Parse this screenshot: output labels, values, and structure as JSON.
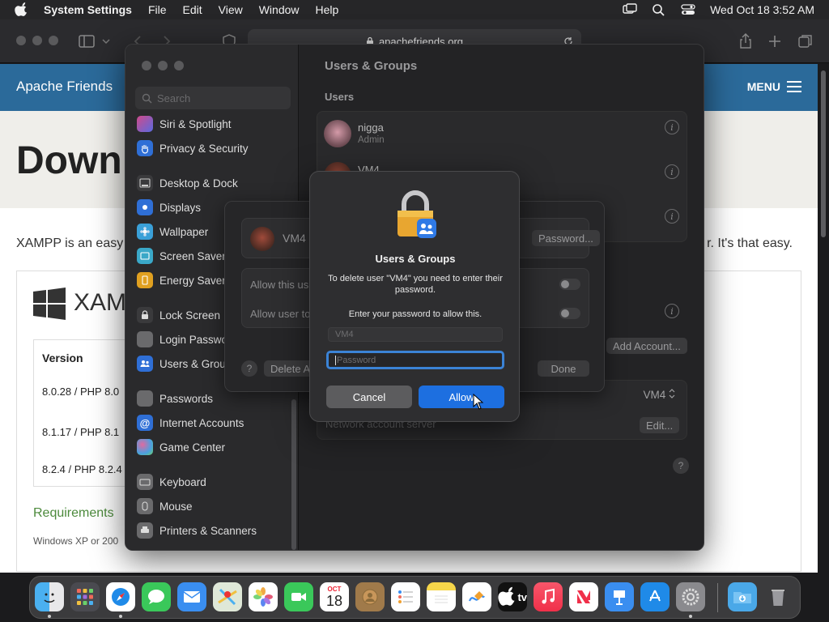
{
  "menubar": {
    "app": "System Settings",
    "items": [
      "File",
      "Edit",
      "View",
      "Window",
      "Help"
    ],
    "datetime": "Wed Oct 18  3:52 AM"
  },
  "safari": {
    "url": "apachefriends.org"
  },
  "webpage": {
    "brand": "Apache Friends",
    "menu": "MENU",
    "hero_title": "Down",
    "intro_left": "XAMPP is an easy",
    "intro_right": "r. It's that easy.",
    "product": "XAMP",
    "version_header": "Version",
    "versions": [
      "8.0.28 / PHP 8.0",
      "8.1.17 / PHP 8.1",
      "8.2.4 / PHP 8.2.4"
    ],
    "requirements": "Requirements",
    "requirements_text": "Windows XP or 200"
  },
  "settings": {
    "search_placeholder": "Search",
    "sidebar": [
      {
        "label": "Siri & Spotlight",
        "icon": "siri-icon",
        "color": "#8a4fd0"
      },
      {
        "label": "Privacy & Security",
        "icon": "hand-icon",
        "color": "#2f6fd6"
      },
      {
        "label": "Desktop & Dock",
        "icon": "dock-icon",
        "color": "#3a3a3c"
      },
      {
        "label": "Displays",
        "icon": "sun-icon",
        "color": "#2f6fd6"
      },
      {
        "label": "Wallpaper",
        "icon": "flower-icon",
        "color": "#3aa0d8"
      },
      {
        "label": "Screen Saver",
        "icon": "screensaver-icon",
        "color": "#3aa8c8"
      },
      {
        "label": "Energy Saver",
        "icon": "battery-icon",
        "color": "#e0a020"
      },
      {
        "label": "Lock Screen",
        "icon": "lock-icon",
        "color": "#3a3a3c"
      },
      {
        "label": "Login Password",
        "icon": "key-icon",
        "color": "#7a7a7c"
      },
      {
        "label": "Users & Groups",
        "icon": "users-icon",
        "color": "#2f6fd6"
      },
      {
        "label": "Passwords",
        "icon": "key-icon",
        "color": "#7a7a7c"
      },
      {
        "label": "Internet Accounts",
        "icon": "at-icon",
        "color": "#2f6fd6"
      },
      {
        "label": "Game Center",
        "icon": "gamecenter-icon",
        "color": "#d04a8a"
      },
      {
        "label": "Keyboard",
        "icon": "keyboard-icon",
        "color": "#7a7a7c"
      },
      {
        "label": "Mouse",
        "icon": "mouse-icon",
        "color": "#7a7a7c"
      },
      {
        "label": "Printers & Scanners",
        "icon": "printer-icon",
        "color": "#7a7a7c"
      }
    ],
    "pane_title": "Users & Groups",
    "users_section": "Users",
    "users": [
      {
        "name": "nigga",
        "role": "Admin"
      },
      {
        "name": "VM4",
        "role": ""
      }
    ],
    "add_account": "Add Account...",
    "network_label": "Network account server",
    "network_value": "VM4",
    "edit": "Edit..."
  },
  "sheet": {
    "user_name": "VM4",
    "option1": "Allow this us",
    "option2": "Allow user to",
    "password_button": "Password...",
    "delete_button": "Delete A",
    "done_button": "Done",
    "help": "?"
  },
  "auth_dialog": {
    "title": "Users & Groups",
    "description": "To delete user \"VM4\" you need to enter their password.",
    "prompt": "Enter your password to allow this.",
    "username_value": "VM4",
    "password_placeholder": "Password",
    "cancel": "Cancel",
    "allow": "Allow"
  },
  "dock": {
    "calendar_month": "OCT",
    "calendar_day": "18",
    "tv_label": "tv",
    "apps": [
      "Finder",
      "Launchpad",
      "Safari",
      "Messages",
      "Mail",
      "Maps",
      "Photos",
      "FaceTime",
      "Calendar",
      "Contacts",
      "Reminders",
      "Notes",
      "Freeform",
      "TV",
      "Music",
      "News",
      "Keynote",
      "App Store",
      "System Settings",
      "Downloads",
      "Trash"
    ]
  }
}
